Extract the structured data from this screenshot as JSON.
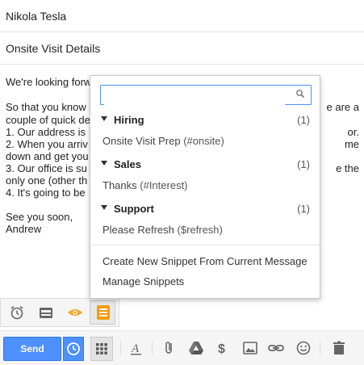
{
  "compose": {
    "to": "Nikola Tesla",
    "subject": "Onsite Visit Details",
    "body_lines_left": [
      "We're looking forw",
      "So that you know",
      "couple of quick de",
      "1. Our address is",
      "2. When you arriv",
      "down and get you",
      "3. Our office is su",
      "only one (other th",
      "4. It's going to be",
      "See you soon,",
      "Andrew"
    ],
    "body_lines_right": [
      "e are a",
      "or.",
      "me",
      "e the"
    ]
  },
  "snippets": {
    "search_placeholder": "",
    "groups": [
      {
        "name": "Hiring",
        "count": "(1)",
        "item_title": "Onsite Visit Prep",
        "item_shortcut": "(#onsite)"
      },
      {
        "name": "Sales",
        "count": "(1)",
        "item_title": "Thanks",
        "item_shortcut": "(#Interest)"
      },
      {
        "name": "Support",
        "count": "(1)",
        "item_title": "Please Refresh",
        "item_shortcut": "($refresh)"
      }
    ],
    "actions": {
      "create": "Create New Snippet From Current Message",
      "manage": "Manage Snippets"
    }
  },
  "toolbar": {
    "send_label": "Send"
  },
  "colors": {
    "accent_blue": "#4d90fe",
    "snippet_orange": "#f39c12",
    "eye_orange": "#f5a623"
  },
  "icons": {
    "mini": [
      "alarm-clock-icon",
      "inbox-tray-icon",
      "eye-icon",
      "snippet-list-icon"
    ],
    "bottom": [
      "clock-icon",
      "grid-icon",
      "text-format-icon",
      "attachment-icon",
      "drive-icon",
      "dollar-icon",
      "photo-icon",
      "link-icon",
      "emoji-icon",
      "trash-icon"
    ]
  }
}
